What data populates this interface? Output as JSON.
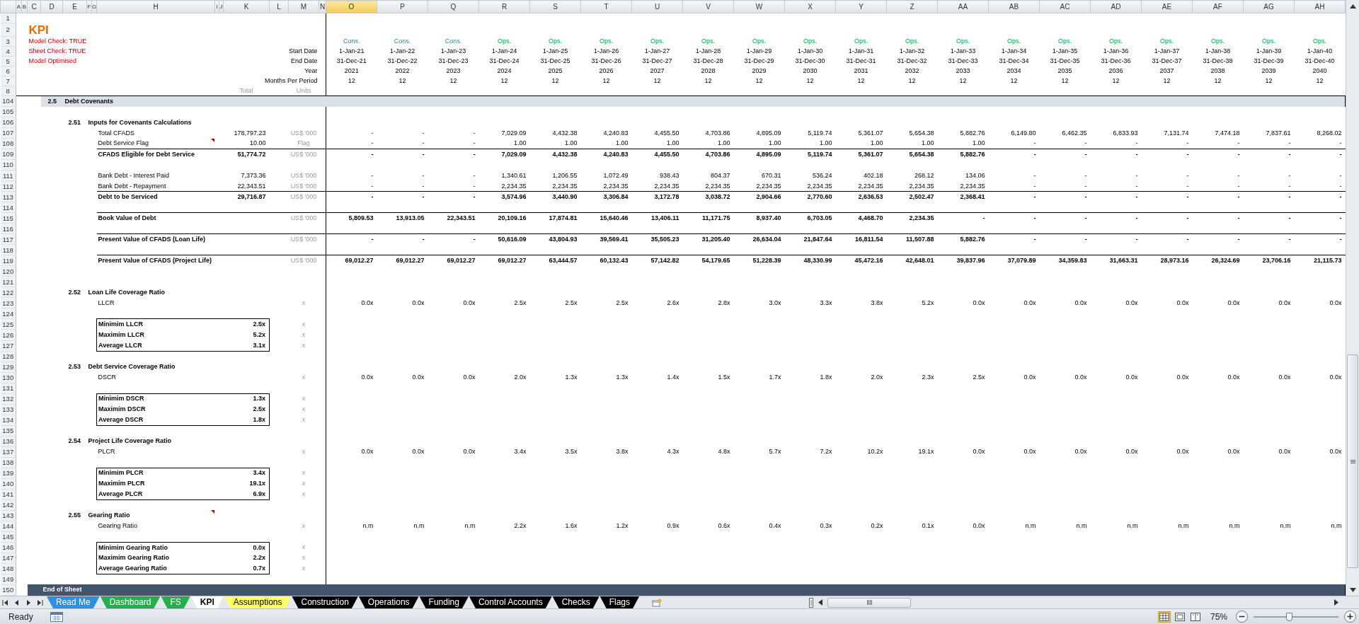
{
  "columns": [
    {
      "letter": "A",
      "selected": false
    },
    {
      "letter": "B",
      "selected": false
    },
    {
      "letter": "C",
      "selected": false
    },
    {
      "letter": "D",
      "selected": false
    },
    {
      "letter": "E",
      "selected": false
    },
    {
      "letter": "F",
      "selected": false
    },
    {
      "letter": "G",
      "selected": false
    },
    {
      "letter": "H",
      "selected": false
    },
    {
      "letter": "I",
      "selected": false
    },
    {
      "letter": "J",
      "selected": false
    },
    {
      "letter": "K",
      "selected": false
    },
    {
      "letter": "L",
      "selected": false
    },
    {
      "letter": "M",
      "selected": false
    },
    {
      "letter": "N",
      "selected": false
    },
    {
      "letter": "O",
      "selected": true
    },
    {
      "letter": "P",
      "selected": false
    },
    {
      "letter": "Q",
      "selected": false
    },
    {
      "letter": "R",
      "selected": false
    },
    {
      "letter": "S",
      "selected": false
    },
    {
      "letter": "T",
      "selected": false
    },
    {
      "letter": "U",
      "selected": false
    },
    {
      "letter": "V",
      "selected": false
    },
    {
      "letter": "W",
      "selected": false
    },
    {
      "letter": "X",
      "selected": false
    },
    {
      "letter": "Y",
      "selected": false
    },
    {
      "letter": "Z",
      "selected": false
    },
    {
      "letter": "AA",
      "selected": false
    },
    {
      "letter": "AB",
      "selected": false
    },
    {
      "letter": "AC",
      "selected": false
    },
    {
      "letter": "AD",
      "selected": false
    },
    {
      "letter": "AE",
      "selected": false
    },
    {
      "letter": "AF",
      "selected": false
    },
    {
      "letter": "AG",
      "selected": false
    },
    {
      "letter": "AH",
      "selected": false
    }
  ],
  "header": {
    "row_numbers": [
      "1",
      "2",
      "3",
      "4",
      "5",
      "6",
      "7",
      "8"
    ],
    "title": "KPI",
    "checks": [
      "Model Check: TRUE",
      "Sheet Check: TRUE",
      "Model Optimised"
    ],
    "period_labels": [
      "Start Date",
      "End Date",
      "Year",
      "Months Per Period"
    ],
    "total_label": "Total",
    "units_label": "Units"
  },
  "periods": [
    {
      "phase": "Cons.",
      "kind": "construction",
      "start": "1-Jan-21",
      "end": "31-Dec-21",
      "year": "2021",
      "months": "12"
    },
    {
      "phase": "Cons.",
      "kind": "construction",
      "start": "1-Jan-22",
      "end": "31-Dec-22",
      "year": "2022",
      "months": "12"
    },
    {
      "phase": "Cons.",
      "kind": "construction",
      "start": "1-Jan-23",
      "end": "31-Dec-23",
      "year": "2023",
      "months": "12"
    },
    {
      "phase": "Ops.",
      "kind": "operations",
      "start": "1-Jan-24",
      "end": "31-Dec-24",
      "year": "2024",
      "months": "12"
    },
    {
      "phase": "Ops.",
      "kind": "operations",
      "start": "1-Jan-25",
      "end": "31-Dec-25",
      "year": "2025",
      "months": "12"
    },
    {
      "phase": "Ops.",
      "kind": "operations",
      "start": "1-Jan-26",
      "end": "31-Dec-26",
      "year": "2026",
      "months": "12"
    },
    {
      "phase": "Ops.",
      "kind": "operations",
      "start": "1-Jan-27",
      "end": "31-Dec-27",
      "year": "2027",
      "months": "12"
    },
    {
      "phase": "Ops.",
      "kind": "operations",
      "start": "1-Jan-28",
      "end": "31-Dec-28",
      "year": "2028",
      "months": "12"
    },
    {
      "phase": "Ops.",
      "kind": "operations",
      "start": "1-Jan-29",
      "end": "31-Dec-29",
      "year": "2029",
      "months": "12"
    },
    {
      "phase": "Ops.",
      "kind": "operations",
      "start": "1-Jan-30",
      "end": "31-Dec-30",
      "year": "2030",
      "months": "12"
    },
    {
      "phase": "Ops.",
      "kind": "operations",
      "start": "1-Jan-31",
      "end": "31-Dec-31",
      "year": "2031",
      "months": "12"
    },
    {
      "phase": "Ops.",
      "kind": "operations",
      "start": "1-Jan-32",
      "end": "31-Dec-32",
      "year": "2032",
      "months": "12"
    },
    {
      "phase": "Ops.",
      "kind": "operations",
      "start": "1-Jan-33",
      "end": "31-Dec-33",
      "year": "2033",
      "months": "12"
    },
    {
      "phase": "Ops.",
      "kind": "operations",
      "start": "1-Jan-34",
      "end": "31-Dec-34",
      "year": "2034",
      "months": "12"
    },
    {
      "phase": "Ops.",
      "kind": "operations",
      "start": "1-Jan-35",
      "end": "31-Dec-35",
      "year": "2035",
      "months": "12"
    },
    {
      "phase": "Ops.",
      "kind": "operations",
      "start": "1-Jan-36",
      "end": "31-Dec-36",
      "year": "2036",
      "months": "12"
    },
    {
      "phase": "Ops.",
      "kind": "operations",
      "start": "1-Jan-37",
      "end": "31-Dec-37",
      "year": "2037",
      "months": "12"
    },
    {
      "phase": "Ops.",
      "kind": "operations",
      "start": "1-Jan-38",
      "end": "31-Dec-38",
      "year": "2038",
      "months": "12"
    },
    {
      "phase": "Ops.",
      "kind": "operations",
      "start": "1-Jan-39",
      "end": "31-Dec-39",
      "year": "2039",
      "months": "12"
    },
    {
      "phase": "Ops.",
      "kind": "operations",
      "start": "1-Jan-40",
      "end": "31-Dec-40",
      "year": "2040",
      "months": "12"
    }
  ],
  "rows": [
    {
      "number": "104",
      "kind": "section",
      "index": "2.5",
      "label": "Debt Covenants"
    },
    {
      "number": "105",
      "kind": "blank"
    },
    {
      "number": "106",
      "kind": "subsection",
      "index": "2.51",
      "label": "Inputs for Covenants Calculations"
    },
    {
      "number": "107",
      "kind": "input",
      "label": "Total CFADS",
      "total": "178,797.23",
      "unit": "US$ '000",
      "values": [
        "-",
        "-",
        "-",
        "7,029.09",
        "4,432.38",
        "4,240.83",
        "4,455.50",
        "4,703.86",
        "4,895.09",
        "5,119.74",
        "5,361.07",
        "5,654.38",
        "5,882.76",
        "6,149.80",
        "6,462.35",
        "6,833.93",
        "7,131.74",
        "7,474.18",
        "7,837.61",
        "8,268.02"
      ]
    },
    {
      "number": "108",
      "kind": "input",
      "label": "Debt Service Flag",
      "total": "10.00",
      "unit": "Flag",
      "comment": true,
      "values": [
        "-",
        "-",
        "-",
        "1.00",
        "1.00",
        "1.00",
        "1.00",
        "1.00",
        "1.00",
        "1.00",
        "1.00",
        "1.00",
        "1.00",
        "-",
        "-",
        "-",
        "-",
        "-",
        "-",
        "-"
      ]
    },
    {
      "number": "109",
      "kind": "total",
      "label": "CFADS Eligible for Debt Service",
      "total": "51,774.72",
      "unit": "US$ '000",
      "values": [
        "-",
        "-",
        "-",
        "7,029.09",
        "4,432.38",
        "4,240.83",
        "4,455.50",
        "4,703.86",
        "4,895.09",
        "5,119.74",
        "5,361.07",
        "5,654.38",
        "5,882.76",
        "-",
        "-",
        "-",
        "-",
        "-",
        "-",
        "-"
      ]
    },
    {
      "number": "110",
      "kind": "blank"
    },
    {
      "number": "111",
      "kind": "input",
      "label": "Bank Debt - Interest Paid",
      "total": "7,373.36",
      "unit": "US$ '000",
      "values": [
        "-",
        "-",
        "-",
        "1,340.61",
        "1,206.55",
        "1,072.49",
        "938.43",
        "804.37",
        "670.31",
        "536.24",
        "402.18",
        "268.12",
        "134.06",
        "-",
        "-",
        "-",
        "-",
        "-",
        "-",
        "-"
      ]
    },
    {
      "number": "112",
      "kind": "input",
      "label": "Bank Debt - Repayment",
      "total": "22,343.51",
      "unit": "US$ '000",
      "values": [
        "-",
        "-",
        "-",
        "2,234.35",
        "2,234.35",
        "2,234.35",
        "2,234.35",
        "2,234.35",
        "2,234.35",
        "2,234.35",
        "2,234.35",
        "2,234.35",
        "2,234.35",
        "-",
        "-",
        "-",
        "-",
        "-",
        "-",
        "-"
      ]
    },
    {
      "number": "113",
      "kind": "total",
      "label": "Debt to be Serviced",
      "total": "29,716.87",
      "unit": "US$ '000",
      "values": [
        "-",
        "-",
        "-",
        "3,574.96",
        "3,440.90",
        "3,306.84",
        "3,172.78",
        "3,038.72",
        "2,904.66",
        "2,770.60",
        "2,636.53",
        "2,502.47",
        "2,368.41",
        "-",
        "-",
        "-",
        "-",
        "-",
        "-",
        "-"
      ]
    },
    {
      "number": "114",
      "kind": "blank"
    },
    {
      "number": "115",
      "kind": "total",
      "label": "Book Value of Debt",
      "unit": "US$ '000",
      "values": [
        "5,809.53",
        "13,913.05",
        "22,343.51",
        "20,109.16",
        "17,874.81",
        "15,640.46",
        "13,406.11",
        "11,171.75",
        "8,937.40",
        "6,703.05",
        "4,468.70",
        "2,234.35",
        "-",
        "-",
        "-",
        "-",
        "-",
        "-",
        "-",
        "-"
      ]
    },
    {
      "number": "116",
      "kind": "blank"
    },
    {
      "number": "117",
      "kind": "total",
      "label": "Present Value of CFADS (Loan Life)",
      "unit": "US$ '000",
      "values": [
        "-",
        "-",
        "-",
        "50,616.09",
        "43,804.93",
        "39,569.41",
        "35,505.23",
        "31,205.40",
        "26,634.04",
        "21,847.64",
        "16,811.54",
        "11,507.88",
        "5,882.76",
        "-",
        "-",
        "-",
        "-",
        "-",
        "-",
        "-"
      ]
    },
    {
      "number": "118",
      "kind": "blank"
    },
    {
      "number": "119",
      "kind": "total",
      "label": "Present Value of CFADS (Project Life)",
      "unit": "US$ '000",
      "values": [
        "69,012.27",
        "69,012.27",
        "69,012.27",
        "69,012.27",
        "63,444.57",
        "60,132.43",
        "57,142.82",
        "54,179.65",
        "51,228.39",
        "48,330.99",
        "45,472.16",
        "42,648.01",
        "39,837.96",
        "37,079.89",
        "34,359.83",
        "31,663.31",
        "28,973.16",
        "26,324.69",
        "23,706.16",
        "21,115.73"
      ]
    },
    {
      "number": "120",
      "kind": "blank"
    },
    {
      "number": "121",
      "kind": "blank"
    },
    {
      "number": "122",
      "kind": "subsection",
      "index": "2.52",
      "label": "Loan Life Coverage Ratio"
    },
    {
      "number": "123",
      "kind": "ratio",
      "label": "LLCR",
      "unit": "x",
      "values": [
        "0.0x",
        "0.0x",
        "0.0x",
        "2.5x",
        "2.5x",
        "2.5x",
        "2.6x",
        "2.8x",
        "3.0x",
        "3.3x",
        "3.8x",
        "5.2x",
        "0.0x",
        "0.0x",
        "0.0x",
        "0.0x",
        "0.0x",
        "0.0x",
        "0.0x",
        "0.0x"
      ]
    },
    {
      "number": "124",
      "kind": "blank"
    },
    {
      "number": "125",
      "kind": "summary",
      "label": "Minimim LLCR",
      "total": "2.5x",
      "unit": "x"
    },
    {
      "number": "126",
      "kind": "summary",
      "label": "Maximim LLCR",
      "total": "5.2x",
      "unit": "x"
    },
    {
      "number": "127",
      "kind": "summary",
      "label": "Average LLCR",
      "total": "3.1x",
      "unit": "x"
    },
    {
      "number": "128",
      "kind": "blank"
    },
    {
      "number": "129",
      "kind": "subsection",
      "index": "2.53",
      "label": "Debt Service Coverage Ratio"
    },
    {
      "number": "130",
      "kind": "ratio",
      "label": "DSCR",
      "unit": "x",
      "values": [
        "0.0x",
        "0.0x",
        "0.0x",
        "2.0x",
        "1.3x",
        "1.3x",
        "1.4x",
        "1.5x",
        "1.7x",
        "1.8x",
        "2.0x",
        "2.3x",
        "2.5x",
        "0.0x",
        "0.0x",
        "0.0x",
        "0.0x",
        "0.0x",
        "0.0x",
        "0.0x"
      ]
    },
    {
      "number": "131",
      "kind": "blank"
    },
    {
      "number": "132",
      "kind": "summary",
      "label": "Minimim DSCR",
      "total": "1.3x",
      "unit": "x"
    },
    {
      "number": "133",
      "kind": "summary",
      "label": "Maximim DSCR",
      "total": "2.5x",
      "unit": "x"
    },
    {
      "number": "134",
      "kind": "summary",
      "label": "Average DSCR",
      "total": "1.8x",
      "unit": "x"
    },
    {
      "number": "135",
      "kind": "blank"
    },
    {
      "number": "136",
      "kind": "subsection",
      "index": "2.54",
      "label": "Project Life Coverage Ratio"
    },
    {
      "number": "137",
      "kind": "ratio",
      "label": "PLCR",
      "unit": "x",
      "values": [
        "0.0x",
        "0.0x",
        "0.0x",
        "3.4x",
        "3.5x",
        "3.8x",
        "4.3x",
        "4.8x",
        "5.7x",
        "7.2x",
        "10.2x",
        "19.1x",
        "0.0x",
        "0.0x",
        "0.0x",
        "0.0x",
        "0.0x",
        "0.0x",
        "0.0x",
        "0.0x"
      ]
    },
    {
      "number": "138",
      "kind": "blank"
    },
    {
      "number": "139",
      "kind": "summary",
      "label": "Minimim PLCR",
      "total": "3.4x",
      "unit": "x"
    },
    {
      "number": "140",
      "kind": "summary",
      "label": "Maximim PLCR",
      "total": "19.1x",
      "unit": "x"
    },
    {
      "number": "141",
      "kind": "summary",
      "label": "Average PLCR",
      "total": "6.9x",
      "unit": "x"
    },
    {
      "number": "142",
      "kind": "blank"
    },
    {
      "number": "143",
      "kind": "subsection",
      "index": "2.55",
      "label": "Gearing Ratio",
      "comment": true
    },
    {
      "number": "144",
      "kind": "ratio",
      "label": "Gearing Ratio",
      "unit": "x",
      "values": [
        "n.m",
        "n.m",
        "n.m",
        "2.2x",
        "1.6x",
        "1.2x",
        "0.9x",
        "0.6x",
        "0.4x",
        "0.3x",
        "0.2x",
        "0.1x",
        "0.0x",
        "n.m",
        "n.m",
        "n.m",
        "n.m",
        "n.m",
        "n.m",
        "n.m"
      ]
    },
    {
      "number": "145",
      "kind": "blank"
    },
    {
      "number": "146",
      "kind": "summary",
      "label": "Minimim Gearing Ratio",
      "total": "0.0x",
      "unit": "x"
    },
    {
      "number": "147",
      "kind": "summary",
      "label": "Maximim Gearing Ratio",
      "total": "2.2x",
      "unit": "x"
    },
    {
      "number": "148",
      "kind": "summary",
      "label": "Average Gearing Ratio",
      "total": "0.7x",
      "unit": "x"
    },
    {
      "number": "149",
      "kind": "blank"
    },
    {
      "number": "150",
      "kind": "end",
      "label": "End of Sheet"
    }
  ],
  "sheet_tabs": [
    {
      "label": "Read Me",
      "color": "#2f8fe0",
      "selected": false
    },
    {
      "label": "Dashboard",
      "color": "#22b14c",
      "selected": false
    },
    {
      "label": "FS",
      "color": "#22b14c",
      "selected": false
    },
    {
      "label": "KPI",
      "selected": true
    },
    {
      "label": "Assumptions",
      "color": "#ffff66",
      "selected": false
    },
    {
      "label": "Construction",
      "color": "#000000",
      "selected": false
    },
    {
      "label": "Operations",
      "color": "#000000",
      "selected": false
    },
    {
      "label": "Funding",
      "color": "#000000",
      "selected": false
    },
    {
      "label": "Control Accounts",
      "color": "#000000",
      "selected": false
    },
    {
      "label": "Checks",
      "color": "#000000",
      "selected": false
    },
    {
      "label": "Flags",
      "color": "#000000",
      "selected": false
    }
  ],
  "status_bar": {
    "mode": "Ready",
    "views": [
      {
        "kind": "normal",
        "selected": true
      },
      {
        "kind": "page_layout",
        "selected": false
      },
      {
        "kind": "page_break",
        "selected": false
      }
    ],
    "zoom": "75%",
    "zoom_slider": {
      "level": 0.42
    }
  }
}
